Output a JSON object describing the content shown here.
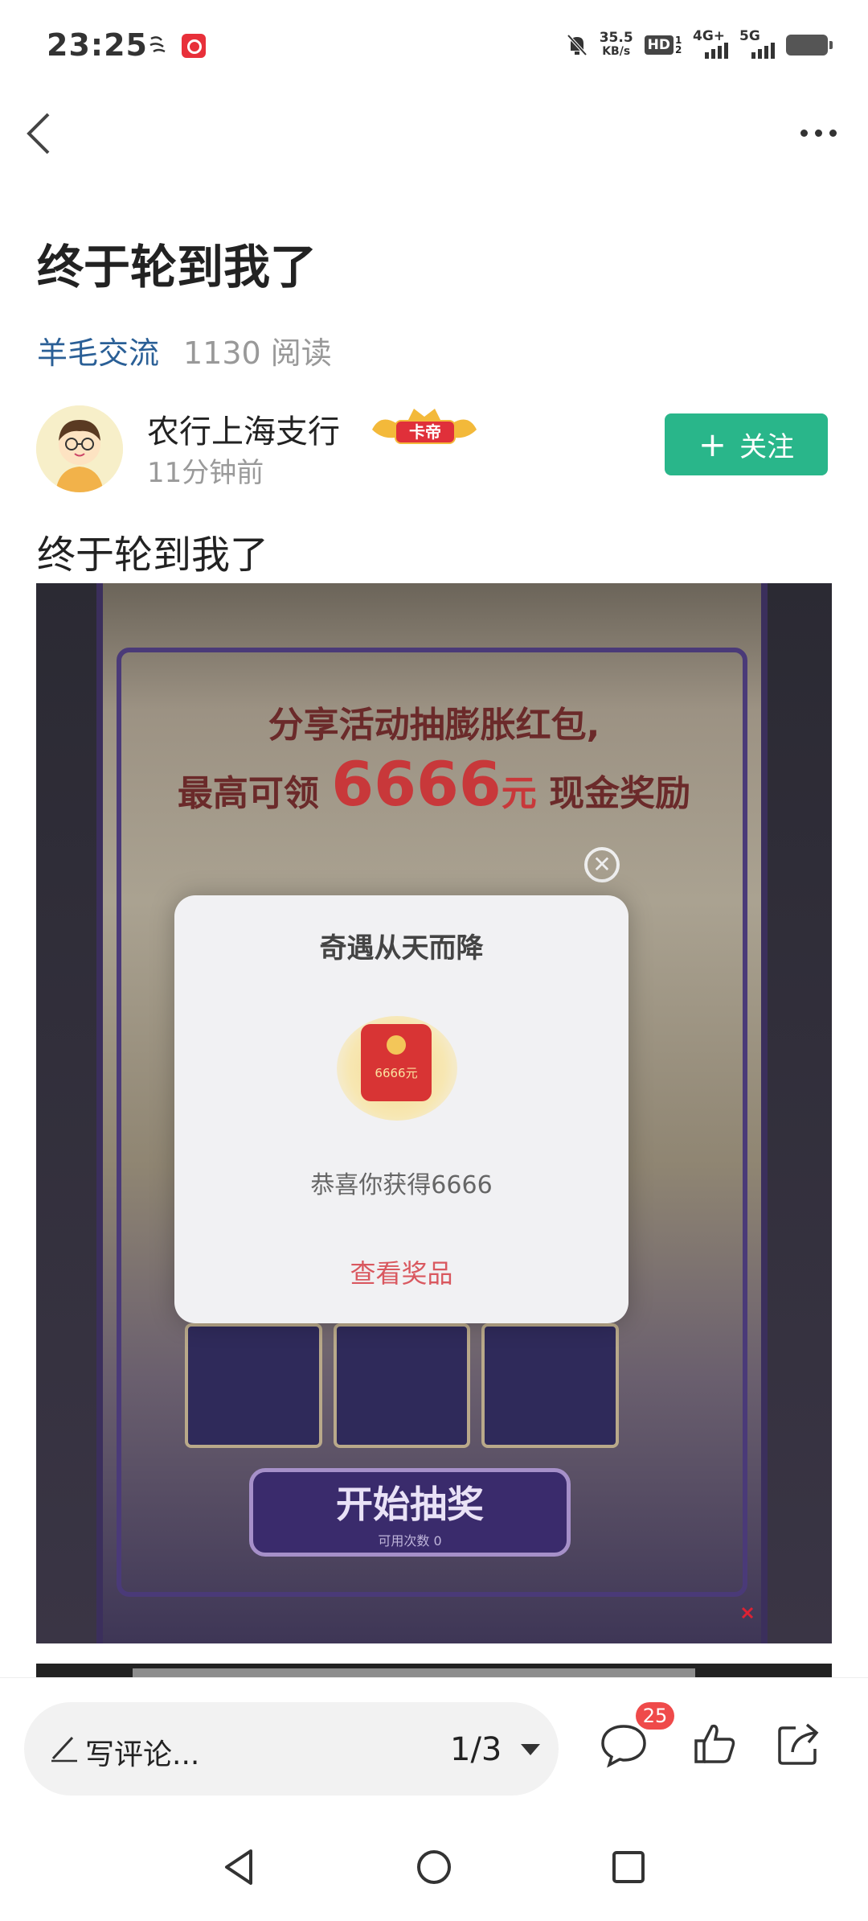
{
  "status_bar": {
    "time": "23:25",
    "net_speed_value": "35.5",
    "net_speed_unit": "KB/s",
    "hd_label": "HD",
    "hd_sub": "1 2",
    "signal1_label": "4G+",
    "signal2_label": "5G"
  },
  "post": {
    "title": "终于轮到我了",
    "category": "羊毛交流",
    "reads": "1130 阅读",
    "body": "终于轮到我了"
  },
  "author": {
    "name": "农行上海支行",
    "time": "11分钟前",
    "rank_badge": "卡帝",
    "follow_label": "关注",
    "follow_plus": "+"
  },
  "image": {
    "headline_line1": "分享活动抽膨胀红包,",
    "headline_line2_prefix": "最高可领",
    "headline_amount": "6666",
    "headline_amount_unit": "元",
    "headline_line2_suffix": "现金奖励",
    "dialog_title": "奇遇从天而降",
    "dialog_packet_amount": "6666元",
    "dialog_message": "恭喜你获得6666",
    "dialog_link": "查看奖品",
    "close_glyph": "✕",
    "draw_button": "开始抽奖",
    "draw_sub": "可用次数 0"
  },
  "bottom_bar": {
    "comment_placeholder": "写评论...",
    "page_counter": "1/3",
    "comment_count": "25"
  },
  "colors": {
    "accent_green": "#29b68a",
    "category_blue": "#2a5f96",
    "badge_red": "#ef4a4a"
  }
}
